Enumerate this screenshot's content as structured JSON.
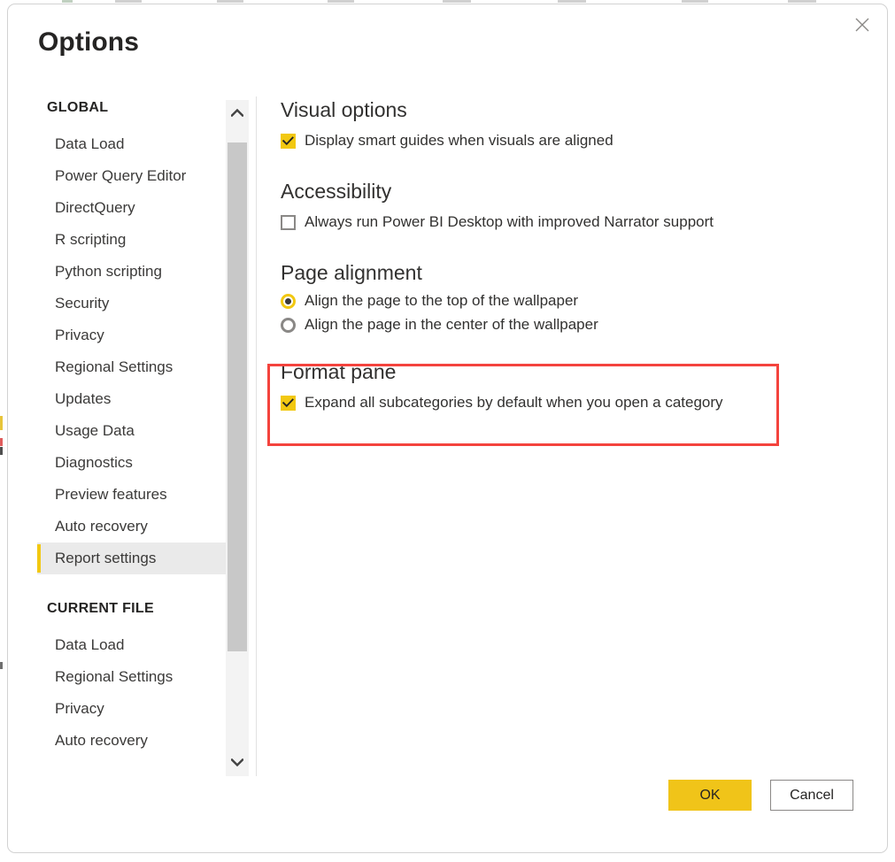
{
  "dialog": {
    "title": "Options",
    "close_icon": "close-icon"
  },
  "sidebar": {
    "sections": [
      {
        "title": "GLOBAL",
        "items": [
          {
            "label": "Data Load",
            "selected": false
          },
          {
            "label": "Power Query Editor",
            "selected": false
          },
          {
            "label": "DirectQuery",
            "selected": false
          },
          {
            "label": "R scripting",
            "selected": false
          },
          {
            "label": "Python scripting",
            "selected": false
          },
          {
            "label": "Security",
            "selected": false
          },
          {
            "label": "Privacy",
            "selected": false
          },
          {
            "label": "Regional Settings",
            "selected": false
          },
          {
            "label": "Updates",
            "selected": false
          },
          {
            "label": "Usage Data",
            "selected": false
          },
          {
            "label": "Diagnostics",
            "selected": false
          },
          {
            "label": "Preview features",
            "selected": false
          },
          {
            "label": "Auto recovery",
            "selected": false
          },
          {
            "label": "Report settings",
            "selected": true
          }
        ]
      },
      {
        "title": "CURRENT FILE",
        "items": [
          {
            "label": "Data Load",
            "selected": false
          },
          {
            "label": "Regional Settings",
            "selected": false
          },
          {
            "label": "Privacy",
            "selected": false
          },
          {
            "label": "Auto recovery",
            "selected": false
          }
        ]
      }
    ],
    "scrollbar": {
      "up_arrow_icon": "chevron-up-icon",
      "down_arrow_icon": "chevron-down-icon"
    }
  },
  "content": {
    "groups": [
      {
        "heading": "Visual options",
        "options": [
          {
            "type": "checkbox",
            "checked": true,
            "label": "Display smart guides when visuals are aligned"
          }
        ]
      },
      {
        "heading": "Accessibility",
        "options": [
          {
            "type": "checkbox",
            "checked": false,
            "label": "Always run Power BI Desktop with improved Narrator support"
          }
        ]
      },
      {
        "heading": "Page alignment",
        "options": [
          {
            "type": "radio",
            "selected": true,
            "label": "Align the page to the top of the wallpaper"
          },
          {
            "type": "radio",
            "selected": false,
            "label": "Align the page in the center of the wallpaper"
          }
        ]
      },
      {
        "heading": "Format pane",
        "highlighted": true,
        "options": [
          {
            "type": "checkbox",
            "checked": true,
            "label": "Expand all subcategories by default when you open a category"
          }
        ]
      }
    ]
  },
  "footer": {
    "ok_label": "OK",
    "cancel_label": "Cancel"
  },
  "colors": {
    "accent_yellow": "#f2c811",
    "ok_button_yellow": "#f0c419",
    "annotation_red": "#f4433d",
    "selected_nav_bg": "#eaeaea",
    "text": "#323130"
  }
}
